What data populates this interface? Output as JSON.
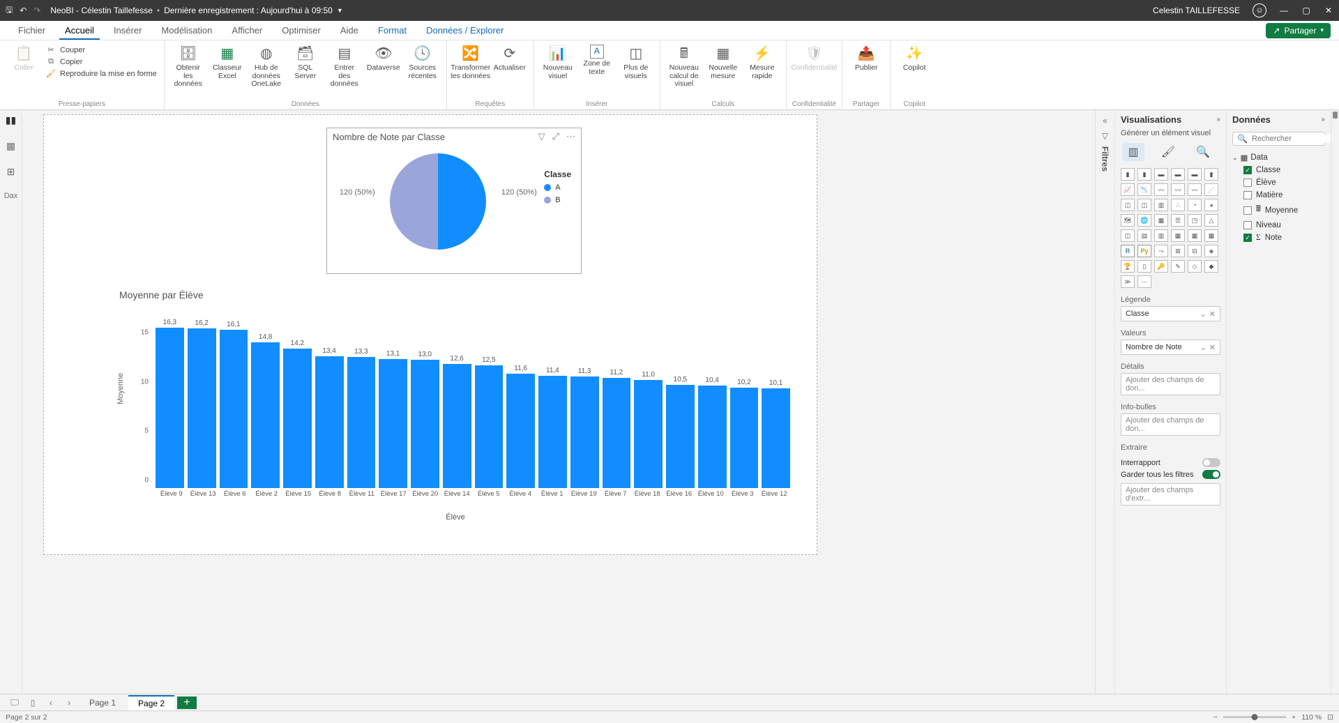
{
  "titlebar": {
    "doc": "NeoBI - Célestin Taillefesse",
    "saved": "Dernière enregistrement : Aujourd'hui à 09:50",
    "user": "Celestin TAILLEFESSE"
  },
  "tabs": {
    "items": [
      "Fichier",
      "Accueil",
      "Insérer",
      "Modélisation",
      "Afficher",
      "Optimiser",
      "Aide",
      "Format",
      "Données / Explorer"
    ],
    "active": "Accueil",
    "share": "Partager"
  },
  "ribbon": {
    "clipboard": {
      "paste": "Coller",
      "cut": "Couper",
      "copy": "Copier",
      "format": "Reproduire la mise en forme",
      "group": "Presse-papiers"
    },
    "data": {
      "get": "Obtenir les données",
      "excel": "Classeur Excel",
      "hub": "Hub de données OneLake",
      "sql": "SQL Server",
      "enter": "Entrer des données",
      "dataverse": "Dataverse",
      "recent": "Sources récentes",
      "group": "Données"
    },
    "queries": {
      "transform": "Transformer les données",
      "refresh": "Actualiser",
      "group": "Requêtes"
    },
    "insert": {
      "visual": "Nouveau visuel",
      "textbox": "Zone de texte",
      "more": "Plus de visuels",
      "group": "Insérer"
    },
    "calc": {
      "measure": "Nouveau calcul de visuel",
      "newmeasure": "Nouvelle mesure",
      "quick": "Mesure rapide",
      "group": "Calculs"
    },
    "conf": {
      "label": "Confidentialité",
      "group": "Confidentialité"
    },
    "share": {
      "publish": "Publier",
      "group": "Partager"
    },
    "copilot": {
      "label": "Copilot",
      "group": "Copilot"
    }
  },
  "filters_label": "Filtres",
  "vispane": {
    "title": "Visualisations",
    "sub": "Générer un élément visuel",
    "legend_h": "Légende",
    "legend_field": "Classe",
    "values_h": "Valeurs",
    "values_field": "Nombre de Note",
    "details_h": "Détails",
    "details_ph": "Ajouter des champs de don...",
    "tooltip_h": "Info-bulles",
    "tooltip_ph": "Ajouter des champs de don...",
    "extract_h": "Extraire",
    "crossreport": "Interrapport",
    "keepfilters": "Garder tous les filtres",
    "extract_ph": "Ajouter des champs d'extr..."
  },
  "datapane": {
    "title": "Données",
    "search_ph": "Rechercher",
    "table": "Data",
    "fields": [
      {
        "name": "Classe",
        "checked": true,
        "icon": ""
      },
      {
        "name": "Élève",
        "checked": false,
        "icon": ""
      },
      {
        "name": "Matière",
        "checked": false,
        "icon": ""
      },
      {
        "name": "Moyenne",
        "checked": false,
        "icon": "calc"
      },
      {
        "name": "Niveau",
        "checked": false,
        "icon": ""
      },
      {
        "name": "Note",
        "checked": true,
        "icon": "sum"
      }
    ]
  },
  "pages": {
    "p1": "Page 1",
    "p2": "Page 2",
    "status": "Page 2 sur 2",
    "zoom": "110 %"
  },
  "chart_data": [
    {
      "type": "pie",
      "title": "Nombre de Note par Classe",
      "legend_title": "Classe",
      "labelA": "120 (50%)",
      "labelB": "120 (50%)",
      "series": [
        {
          "name": "A",
          "value": 120,
          "color": "#118dff"
        },
        {
          "name": "B",
          "value": 120,
          "color": "#9aa5d9"
        }
      ]
    },
    {
      "type": "bar",
      "title": "Moyenne par Élève",
      "ylabel": "Moyenne",
      "xlabel": "Élève",
      "ylim": [
        0,
        17
      ],
      "yticks": [
        0,
        5,
        10,
        15
      ],
      "categories": [
        "Élève 9",
        "Élève 13",
        "Élève 6",
        "Élève 2",
        "Élève 15",
        "Élève 8",
        "Élève 11",
        "Élève 17",
        "Élève 20",
        "Élève 14",
        "Élève 5",
        "Élève 4",
        "Élève 1",
        "Élève 19",
        "Élève 7",
        "Élève 18",
        "Élève 16",
        "Élève 10",
        "Élève 3",
        "Élève 12"
      ],
      "values": [
        16.3,
        16.2,
        16.1,
        14.8,
        14.2,
        13.4,
        13.3,
        13.1,
        13.0,
        12.6,
        12.5,
        11.6,
        11.4,
        11.3,
        11.2,
        11.0,
        10.5,
        10.4,
        10.2,
        10.1
      ]
    }
  ]
}
